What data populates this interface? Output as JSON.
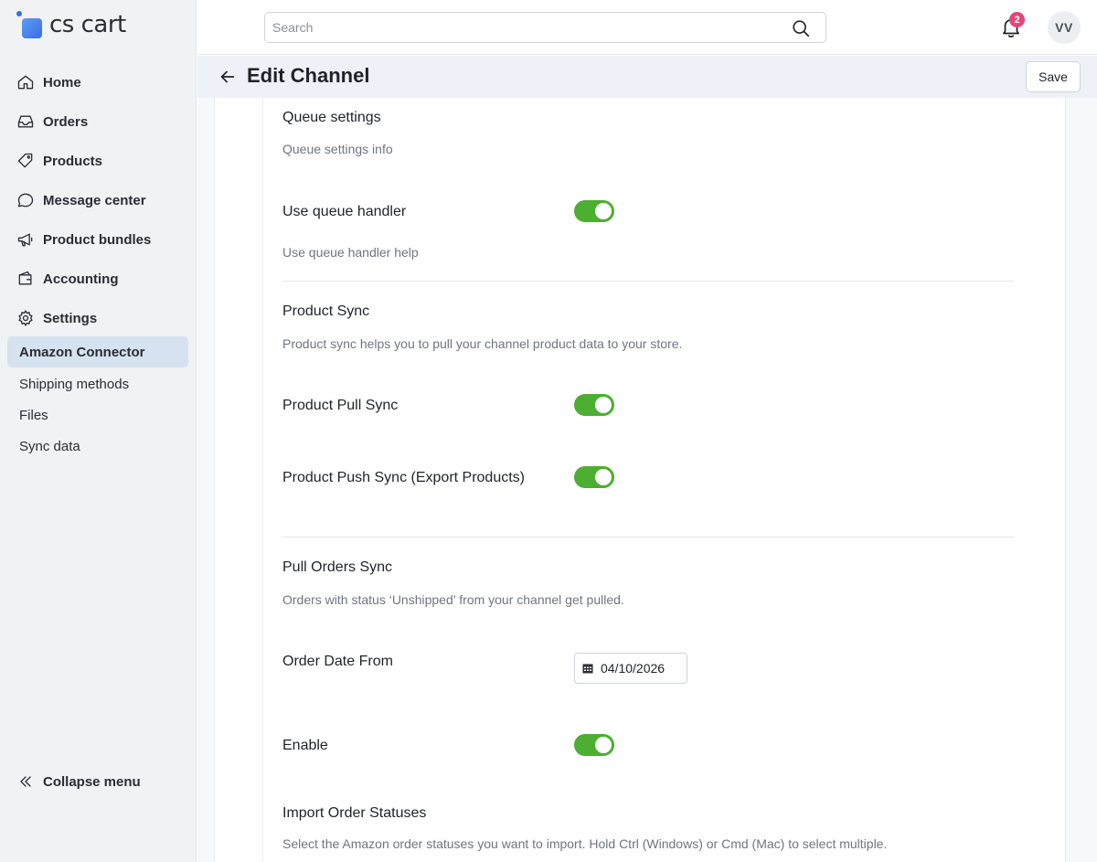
{
  "app": {
    "logo_text": "cs cart"
  },
  "sidebar": {
    "items": [
      {
        "label": "Home",
        "icon": "home-icon"
      },
      {
        "label": "Orders",
        "icon": "inbox-icon"
      },
      {
        "label": "Products",
        "icon": "tag-icon"
      },
      {
        "label": "Message center",
        "icon": "chat-icon"
      },
      {
        "label": "Product bundles",
        "icon": "megaphone-icon"
      },
      {
        "label": "Accounting",
        "icon": "wallet-icon"
      },
      {
        "label": "Settings",
        "icon": "gear-icon"
      }
    ],
    "sub_items": [
      {
        "label": "Amazon Connector",
        "active": true
      },
      {
        "label": "Shipping methods",
        "active": false
      },
      {
        "label": "Files",
        "active": false
      },
      {
        "label": "Sync data",
        "active": false
      }
    ],
    "collapse_label": "Collapse menu"
  },
  "topbar": {
    "search_placeholder": "Search",
    "notification_count": "2",
    "avatar_initials": "VV"
  },
  "header": {
    "title": "Edit Channel",
    "save_label": "Save"
  },
  "form": {
    "queue": {
      "title": "Queue settings",
      "info": "Queue settings info",
      "use_queue_label": "Use queue handler",
      "use_queue_on": true,
      "use_queue_help": "Use queue handler help"
    },
    "product_sync": {
      "title": "Product Sync",
      "info": "Product sync helps you to pull your channel product data to your store.",
      "pull_label": "Product Pull Sync",
      "pull_on": true,
      "push_label": "Product Push Sync (Export Products)",
      "push_on": true
    },
    "orders_sync": {
      "title": "Pull Orders Sync",
      "info": "Orders with status ‘Unshipped’ from your channel get pulled.",
      "date_label": "Order Date From",
      "date_value": "04/10/2026",
      "enable_label": "Enable",
      "enable_on": true
    },
    "import_statuses": {
      "title": "Import Order Statuses",
      "info": "Select the Amazon order statuses you want to import. Hold Ctrl (Windows) or Cmd (Mac) to select multiple."
    }
  },
  "colors": {
    "toggle_on": "#4caf32",
    "badge": "#e8447a",
    "active_nav": "#d6e2f0",
    "sidebar_bg": "#f1f2f4"
  }
}
